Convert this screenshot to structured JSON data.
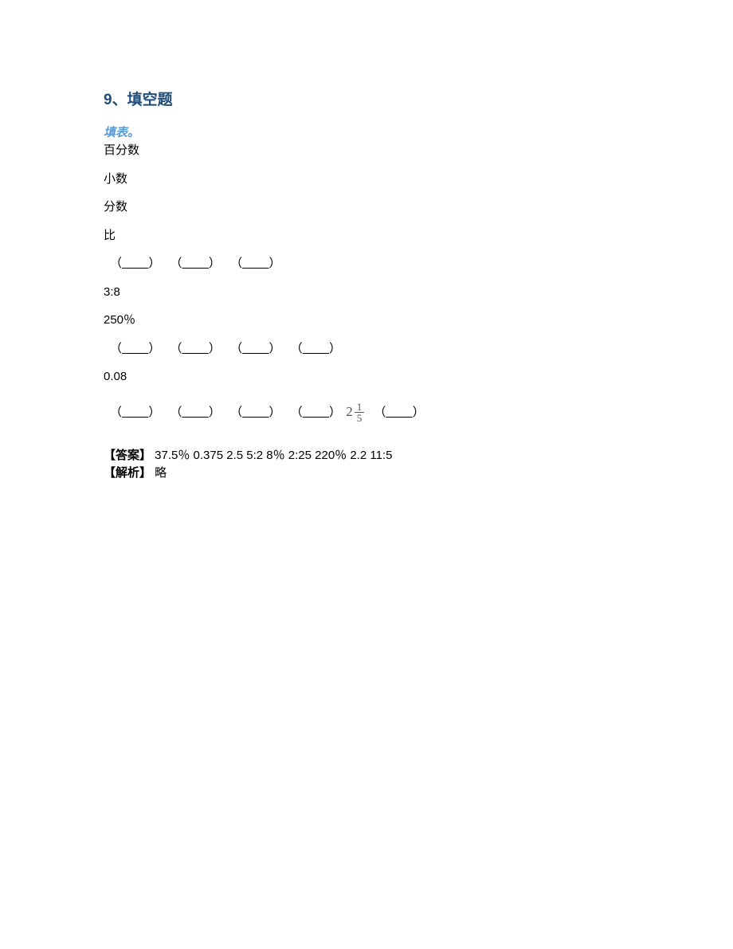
{
  "title": "9、填空题",
  "subtitle": "填表。",
  "labels": {
    "percent": "百分数",
    "decimal": "小数",
    "fraction": "分数",
    "ratio": "比"
  },
  "blank_parens": {
    "open": "（",
    "close": "）",
    "line": "        "
  },
  "given": {
    "ratio1": "3:8",
    "percent1": "250％",
    "decimal1": "0.08"
  },
  "mixed_fraction": {
    "int": "2",
    "num": "1",
    "den": "5"
  },
  "answer_label": "【答案】",
  "answer_text": " 37.5％ 0.375 2.5 5:2 8％ 2:25 220％ 2.2 11:5",
  "analysis_label": "【解析】",
  "analysis_text": " 略"
}
